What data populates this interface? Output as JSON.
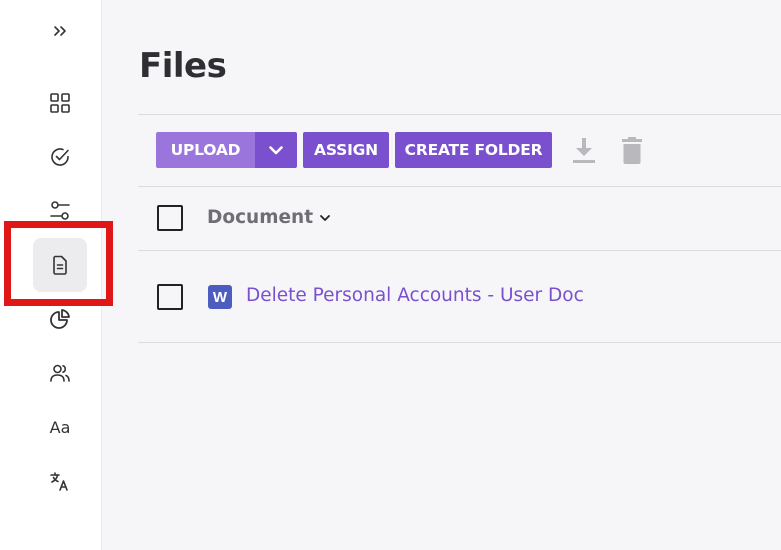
{
  "sidebar": {
    "expand_icon": "double-chevron-right-icon",
    "items": [
      {
        "icon": "dashboard-grid-icon",
        "active": false
      },
      {
        "icon": "check-circle-icon",
        "active": false
      },
      {
        "icon": "sliders-icon",
        "active": false
      },
      {
        "icon": "file-document-icon",
        "active": true
      },
      {
        "icon": "pie-chart-icon",
        "active": false
      },
      {
        "icon": "users-icon",
        "active": false
      },
      {
        "icon": "typography-icon",
        "label": "Aa",
        "active": false
      },
      {
        "icon": "translate-icon",
        "active": false
      }
    ]
  },
  "page": {
    "title": "Files"
  },
  "toolbar": {
    "upload_label": "UPLOAD",
    "assign_label": "ASSIGN",
    "create_folder_label": "CREATE FOLDER",
    "icons": [
      "download-icon",
      "trash-icon"
    ]
  },
  "table": {
    "column_header": "Document",
    "rows": [
      {
        "file_type_letter": "W",
        "name": "Delete Personal Accounts - User Doc"
      }
    ]
  },
  "colors": {
    "accent": "#7a50cf",
    "accent_light": "#9a76dc",
    "highlight": "#e01717",
    "word_icon": "#4c5cbf"
  }
}
